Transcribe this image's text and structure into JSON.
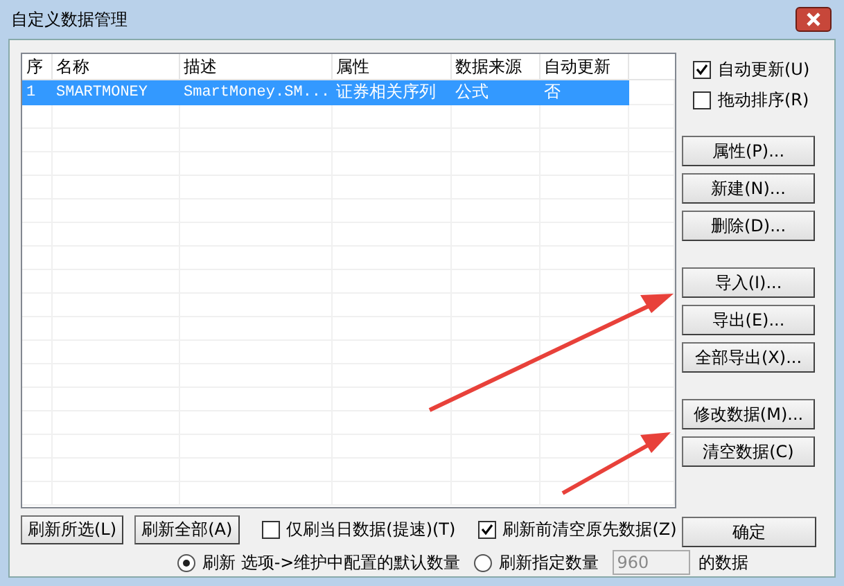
{
  "window": {
    "title": "自定义数据管理"
  },
  "table": {
    "columns": [
      "序",
      "名称",
      "描述",
      "属性",
      "数据来源",
      "自动更新"
    ],
    "rows": [
      {
        "cells": [
          "1",
          "SMARTMONEY",
          "SmartMoney.SM...",
          "证券相关序列",
          "公式",
          "否"
        ],
        "selected": true
      }
    ]
  },
  "options": [
    {
      "label": "自动更新(U)",
      "checked": true
    },
    {
      "label": "拖动排序(R)",
      "checked": false
    }
  ],
  "button_groups": [
    [
      "属性(P)...",
      "新建(N)...",
      "删除(D)..."
    ],
    [
      "导入(I)...",
      "导出(E)...",
      "全部导出(X)..."
    ],
    [
      "修改数据(M)...",
      "清空数据(C)"
    ]
  ],
  "ok_button": "确定",
  "bottom_buttons": [
    "刷新所选(L)",
    "刷新全部(A)"
  ],
  "bottom_checks": [
    {
      "label": "仅刷当日数据(提速)(T)",
      "checked": false
    },
    {
      "label": "刷新前清空原先数据(Z)",
      "checked": true
    }
  ],
  "refresh_mode": [
    {
      "label": "刷新 选项->维护中配置的默认数量",
      "selected": true
    },
    {
      "label": "刷新指定数量",
      "selected": false
    }
  ],
  "count_field": {
    "value": "960",
    "disabled": true
  },
  "suffix": "的数据"
}
